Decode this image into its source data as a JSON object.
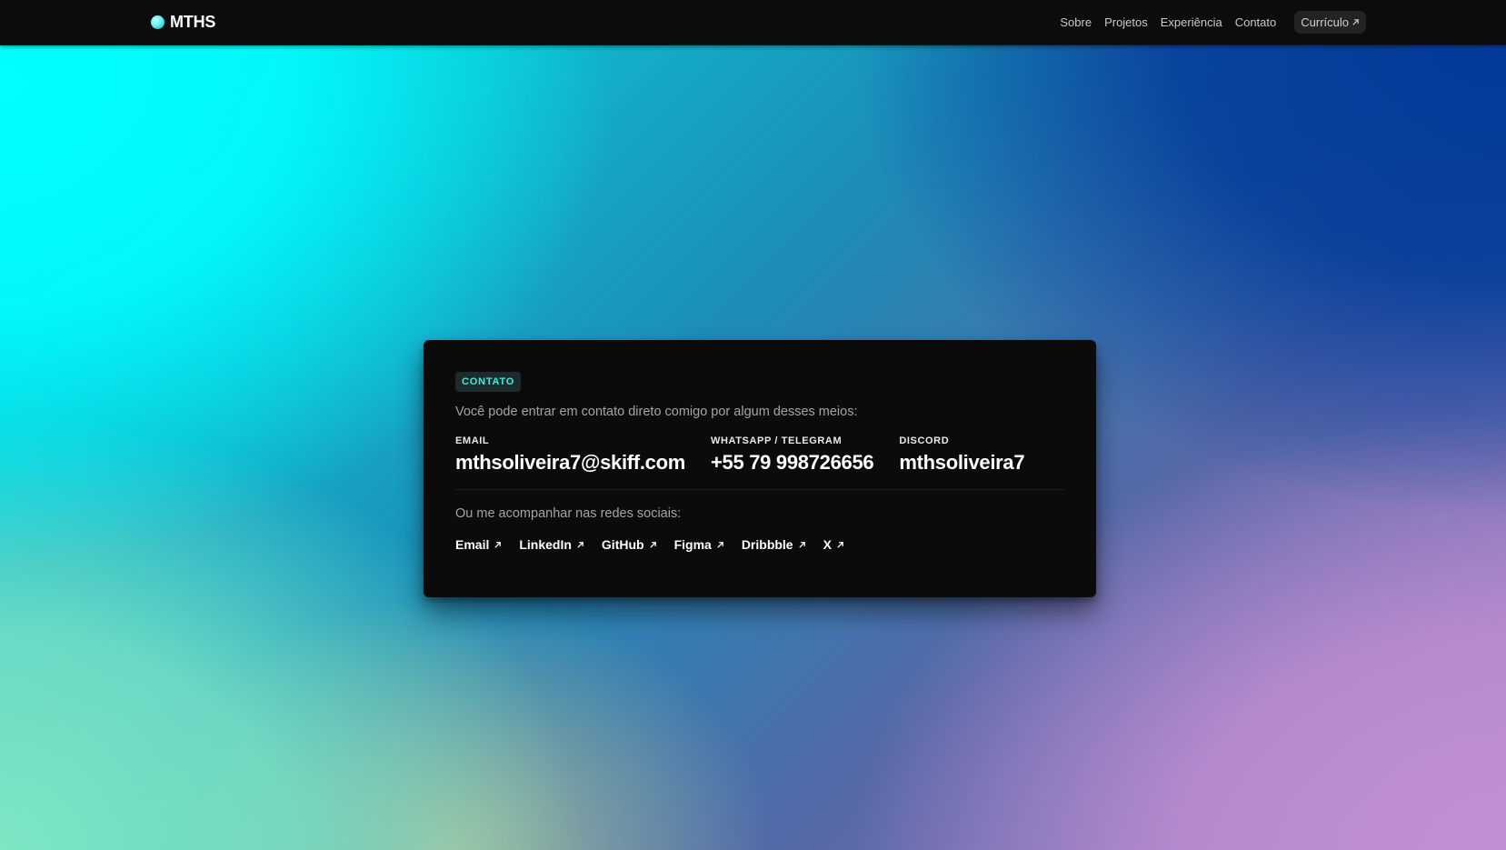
{
  "brand": {
    "name": "MTHS"
  },
  "nav": {
    "items": [
      {
        "label": "Sobre"
      },
      {
        "label": "Projetos"
      },
      {
        "label": "Experiência"
      },
      {
        "label": "Contato"
      }
    ],
    "cv_label": "Currículo"
  },
  "contact": {
    "badge": "CONTATO",
    "intro": "Você pode entrar em contato direto comigo por algum desses meios:",
    "items": [
      {
        "label": "EMAIL",
        "value": "mthsoliveira7@skiff.com"
      },
      {
        "label": "WHATSAPP / TELEGRAM",
        "value": "+55 79 998726656"
      },
      {
        "label": "DISCORD",
        "value": "mthsoliveira7"
      }
    ],
    "social_intro": "Ou me acompanhar nas redes sociais:",
    "socials": [
      {
        "label": "Email"
      },
      {
        "label": "LinkedIn"
      },
      {
        "label": "GitHub"
      },
      {
        "label": "Figma"
      },
      {
        "label": "Dribbble"
      },
      {
        "label": "X"
      }
    ]
  },
  "colors": {
    "accent": "#49e6dc",
    "badge_bg": "#1d2b2c",
    "card_bg": "#0b0b0b",
    "topbar_bg": "#0c0c0c"
  },
  "icons": {
    "external_link": "arrow-up-right-icon",
    "brand_mark": "brand-dot-icon"
  }
}
